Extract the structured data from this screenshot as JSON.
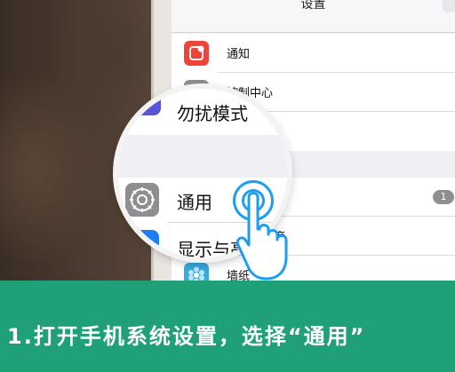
{
  "header": {
    "title": "设置"
  },
  "settings_rows": [
    {
      "label": "通知",
      "icon": "notifications-icon",
      "color": "#f0433a"
    },
    {
      "label": "控制中心",
      "icon": "control-center-icon",
      "color": "#8e8e93"
    },
    {
      "label": "勿扰模式",
      "icon": "do-not-disturb-icon",
      "color": "#5856d6"
    },
    {
      "label": "通用",
      "icon": "gear-icon",
      "color": "#8e8e93",
      "badge": "1"
    },
    {
      "label": "显示与亮度",
      "icon": "display-brightness-icon",
      "color": "#1e7cf2"
    },
    {
      "label": "墙纸",
      "icon": "wallpaper-icon",
      "color": "#36aadc"
    }
  ],
  "magnifier": {
    "row_top": "勿扰模式",
    "row_top_tail": "式",
    "row_middle": "通用",
    "row_bottom": "显示与亮度",
    "row_bottom_tail": "亮度"
  },
  "caption": "1.打开手机系统设置，选择“通用”",
  "colors": {
    "banner": "#20a079",
    "accent": "#1e9df2"
  }
}
